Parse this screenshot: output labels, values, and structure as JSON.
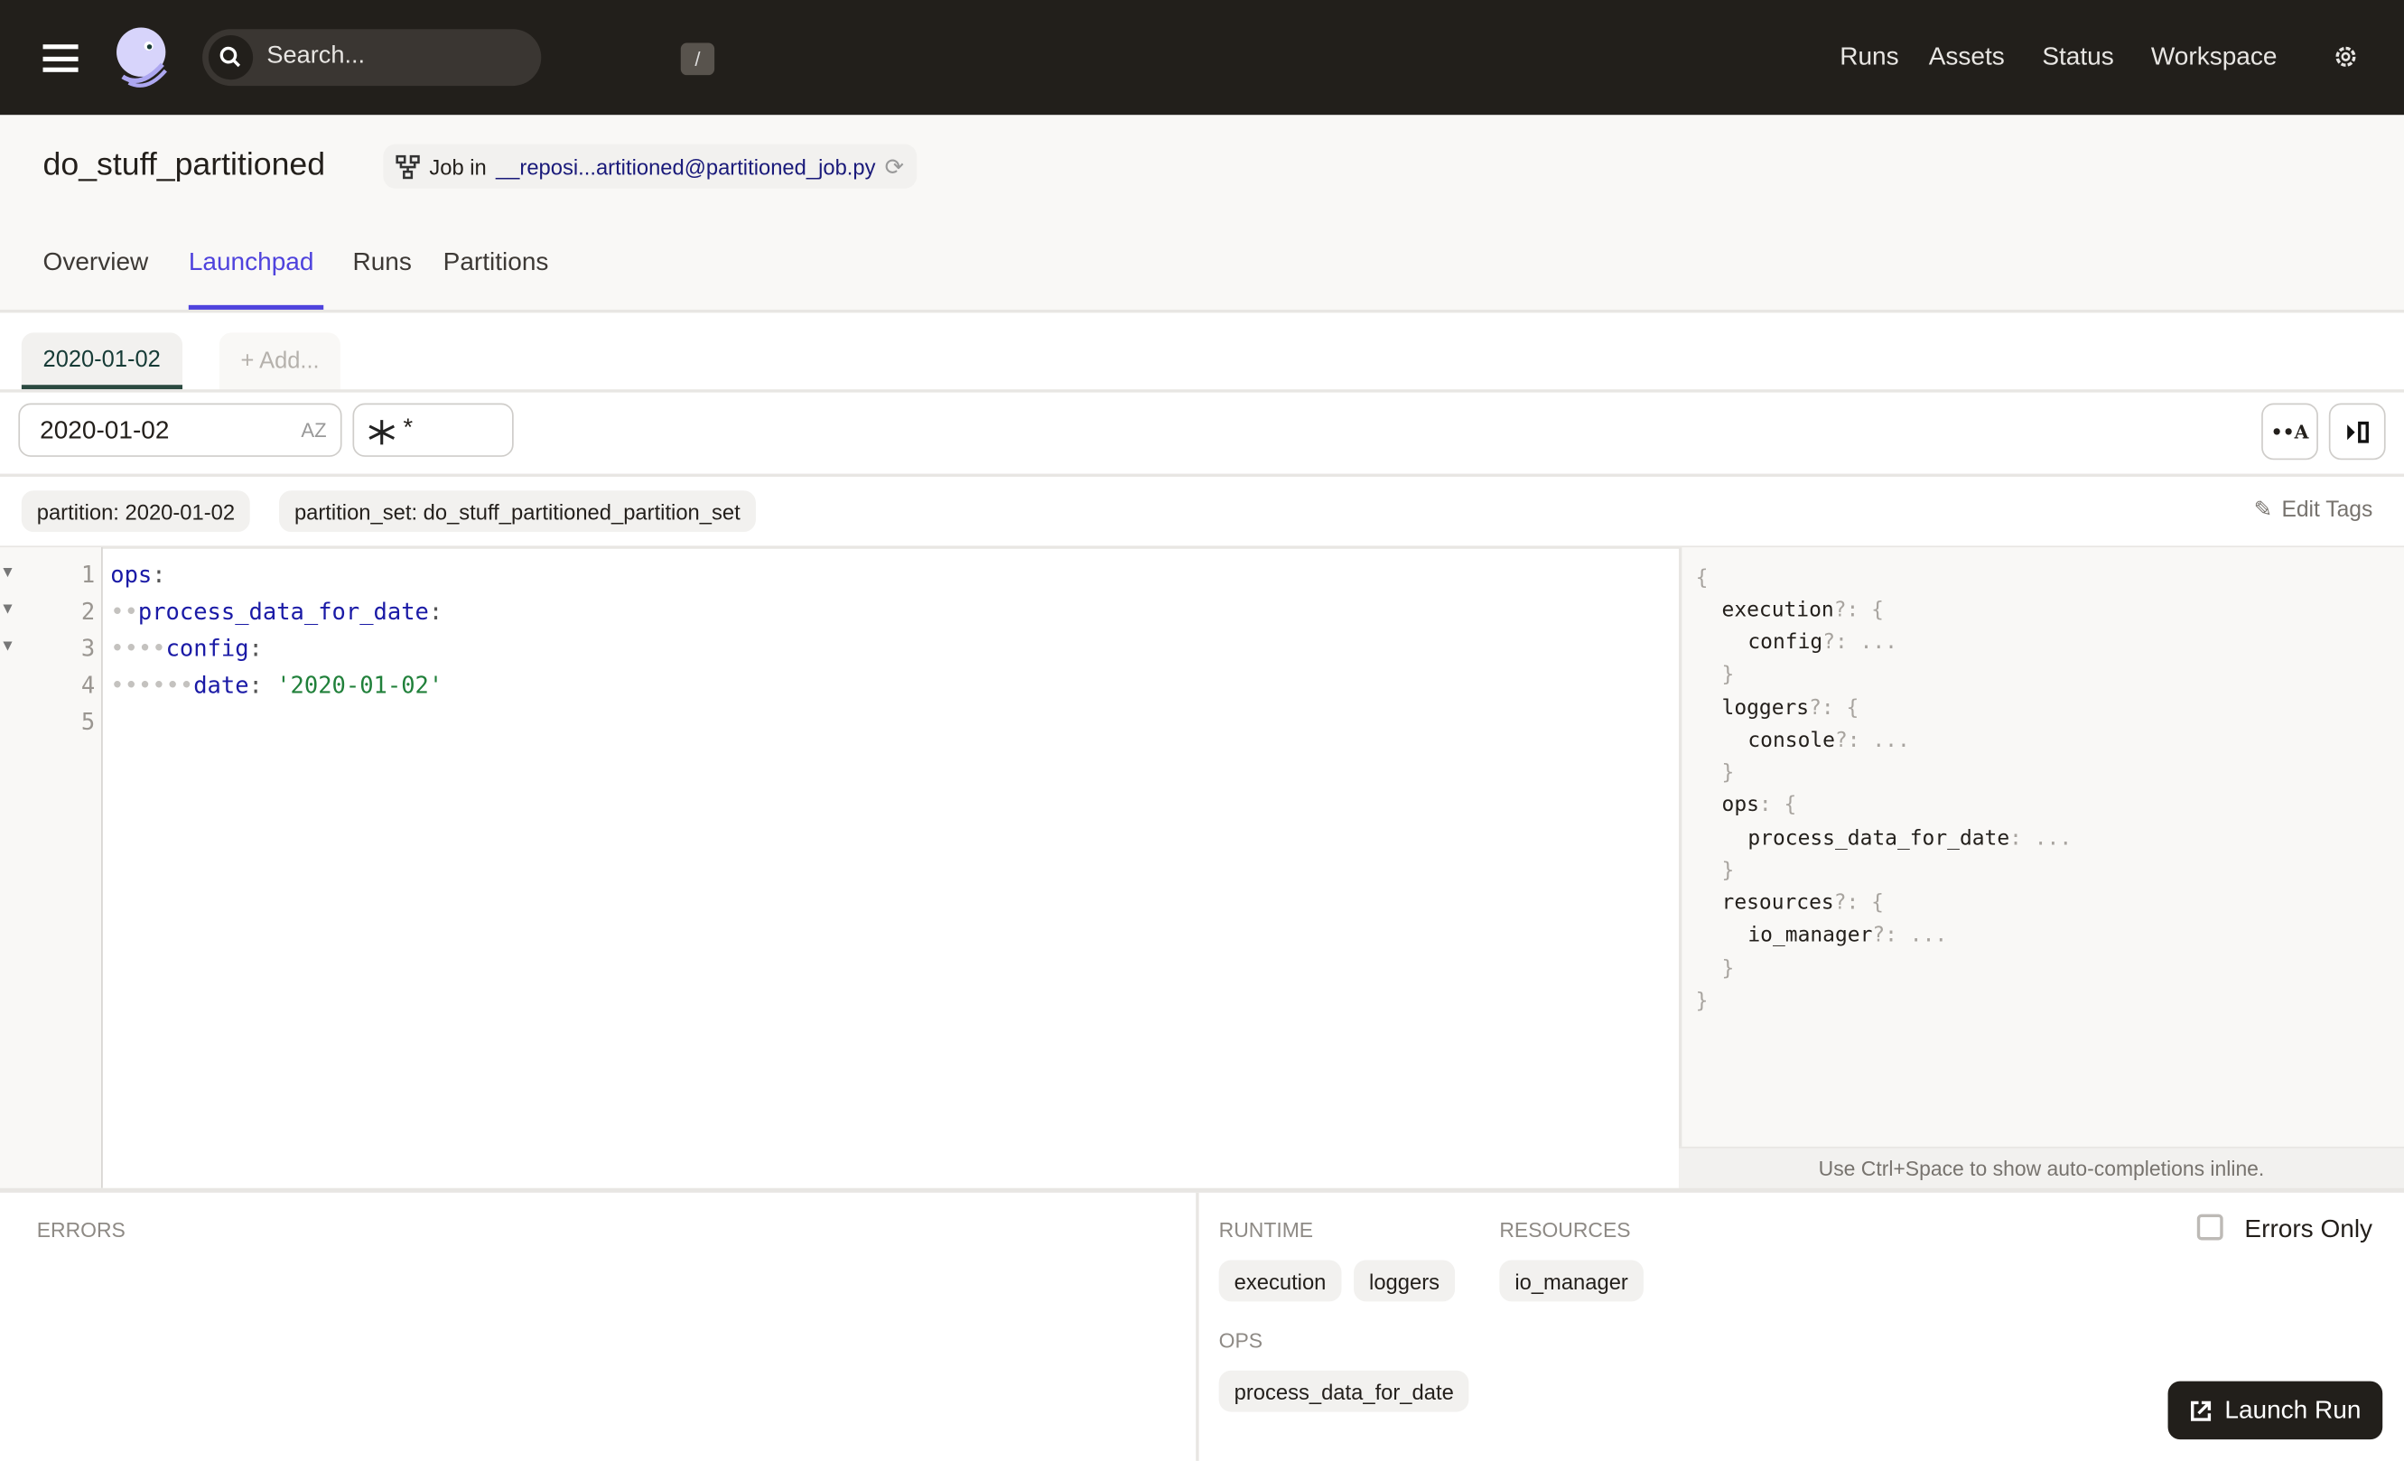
{
  "topbar": {
    "search_placeholder": "Search...",
    "search_shortcut": "/",
    "nav": [
      "Runs",
      "Assets",
      "Status",
      "Workspace"
    ]
  },
  "header": {
    "title": "do_stuff_partitioned",
    "job_prefix": "Job in",
    "job_link": "__reposi...artitioned@partitioned_job.py",
    "tabs": [
      "Overview",
      "Launchpad",
      "Runs",
      "Partitions"
    ],
    "active_tab": "Launchpad"
  },
  "session_tabs": {
    "active": "2020-01-02",
    "add": "+ Add..."
  },
  "toolbar": {
    "partition_value": "2020-01-02",
    "op_selection": "*",
    "sort_icon_label": "AZ",
    "scaffold_label": "••A"
  },
  "tags": [
    "partition: 2020-01-02",
    "partition_set: do_stuff_partitioned_partition_set"
  ],
  "edit_tags": "Edit Tags",
  "editor": {
    "line_numbers": [
      "1",
      "2",
      "3",
      "4",
      "5"
    ],
    "lines": [
      {
        "indent": "",
        "key": "ops",
        "value": ""
      },
      {
        "indent": "••",
        "key": "process_data_for_date",
        "value": ""
      },
      {
        "indent": "••••",
        "key": "config",
        "value": ""
      },
      {
        "indent": "••••••",
        "key": "date",
        "value": "'2020-01-02'"
      },
      {
        "indent": "",
        "key": "",
        "value": ""
      }
    ]
  },
  "schema": {
    "lines": [
      "{",
      "execution",
      "config",
      "}",
      "loggers",
      "console",
      "}",
      "ops",
      "process_data_for_date",
      "}",
      "resources",
      "io_manager",
      "}",
      "}"
    ],
    "hint": "Use Ctrl+Space to show auto-completions inline."
  },
  "bottom": {
    "errors_label": "ERRORS",
    "runtime_label": "RUNTIME",
    "runtime_items": [
      "execution",
      "loggers"
    ],
    "resources_label": "RESOURCES",
    "resources_items": [
      "io_manager"
    ],
    "ops_label": "OPS",
    "ops_items": [
      "process_data_for_date"
    ],
    "errors_only": "Errors Only",
    "errors_only_checked": false,
    "launch": "Launch Run"
  },
  "colors": {
    "accent": "#4f43dd",
    "topbar": "#221f1b",
    "yaml_key": "#1a1aa6",
    "yaml_string": "#20803a"
  }
}
